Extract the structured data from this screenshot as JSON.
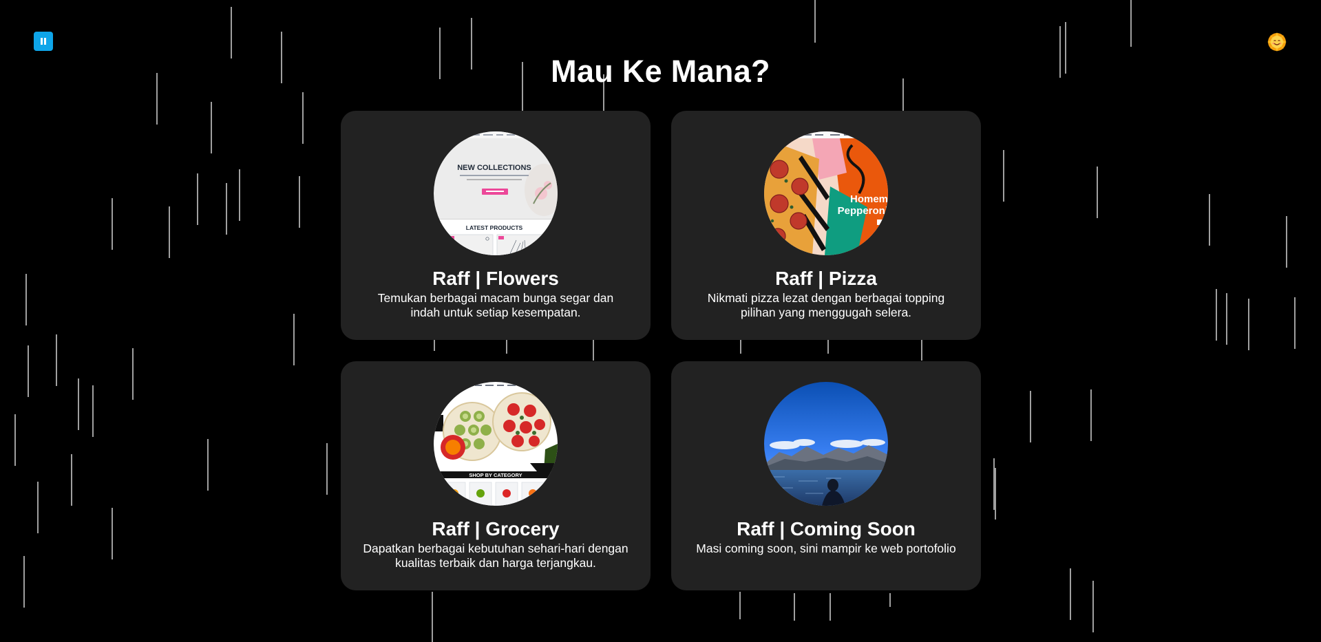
{
  "page": {
    "title": "Mau Ke Mana?",
    "background": "#000000",
    "rain_color": "#a0a0a0"
  },
  "controls": {
    "pause_icon": "pause-icon",
    "pause_color": "#0ea5e9",
    "theme_icon": "sun-face-emoji"
  },
  "cards": [
    {
      "title": "Raff | Flowers",
      "description": "Temukan berbagai macam bunga segar dan indah untuk setiap kesempatan.",
      "thumb": {
        "type": "website-screenshot",
        "headline": "NEW COLLECTIONS",
        "section": "LATEST PRODUCTS",
        "accent": "#ec4899"
      }
    },
    {
      "title": "Raff | Pizza",
      "description": "Nikmati pizza lezat dengan berbagai topping pilihan yang menggugah selera.",
      "thumb": {
        "type": "website-screenshot",
        "headline_lines": [
          "Homem",
          "Pepperoni"
        ]
      }
    },
    {
      "title": "Raff | Grocery",
      "description": "Dapatkan berbagai kebutuhan sehari-hari dengan kualitas terbaik dan harga terjangkau.",
      "thumb": {
        "type": "website-screenshot",
        "section": "SHOP BY CATEGORY"
      }
    },
    {
      "title": "Raff | Coming Soon",
      "description": "Masi coming soon, sini mampir ke web portofolio",
      "thumb": {
        "type": "photo",
        "subject": "person-by-lake-with-mountains"
      }
    }
  ]
}
